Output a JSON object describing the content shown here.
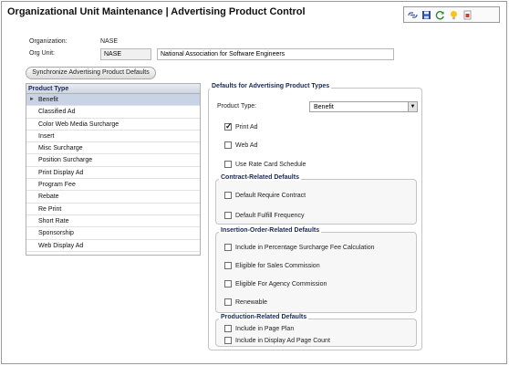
{
  "header": {
    "title": "Organizational Unit Maintenance | Advertising Product Control"
  },
  "toolbar": {
    "icons": [
      "link-icon",
      "save-icon",
      "refresh-icon",
      "help-icon",
      "export-icon"
    ]
  },
  "org": {
    "organization_label": "Organization:",
    "organization_value": "NASE",
    "org_unit_label": "Org Unit:",
    "org_unit_code": "NASE",
    "org_unit_name": "National Association for Software Engineers"
  },
  "sync_button": "Synchronize Advertising Product Defaults",
  "product_list": {
    "header": "Product Type",
    "items": [
      "Benefit",
      "Classified Ad",
      "Color Web Media Surcharge",
      "Insert",
      "Misc Surcharge",
      "Position Surcharge",
      "Print Display Ad",
      "Program Fee",
      "Rebate",
      "Re Print",
      "Short Rate",
      "Sponsorship",
      "Web Display Ad"
    ],
    "selected": "Benefit"
  },
  "defaults": {
    "title": "Defaults for Advertising Product Types",
    "product_type_label": "Product Type:",
    "product_type_value": "Benefit",
    "print_ad": {
      "label": "Print Ad",
      "checked": true
    },
    "web_ad": {
      "label": "Web Ad",
      "checked": false
    },
    "use_rate_card": {
      "label": "Use Rate Card Schedule",
      "checked": false
    },
    "contract": {
      "title": "Contract-Related Defaults",
      "require_contract": "Default Require Contract",
      "fulfill_frequency": "Default Fulfill Frequency"
    },
    "insertion": {
      "title": "Insertion-Order-Related Defaults",
      "include_surcharge": "Include in Percentage Surcharge Fee Calculation",
      "sales_commission": "Eligible for Sales Commission",
      "agency_commission": "Eligible For Agency Commission",
      "renewable": "Renewable"
    },
    "production": {
      "title": "Production-Related Defaults",
      "page_plan": "Include in Page Plan",
      "display_page_count": "Include in Display Ad Page Count"
    }
  }
}
